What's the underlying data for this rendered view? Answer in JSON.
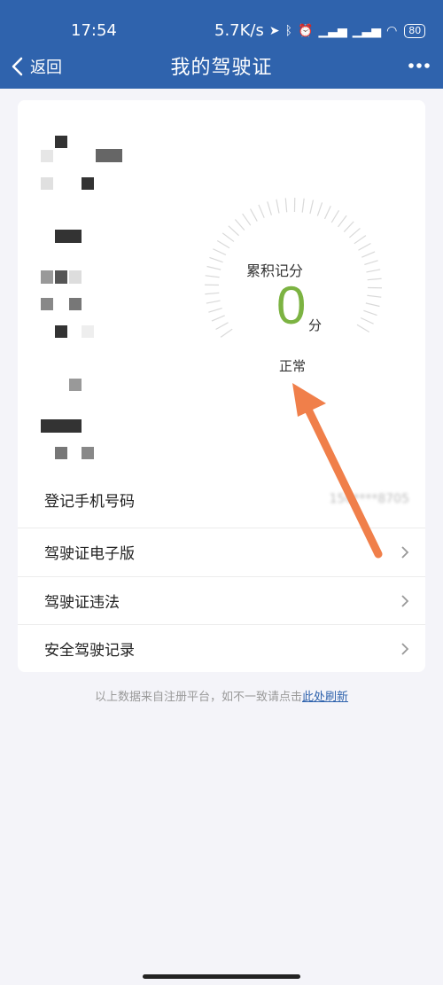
{
  "status_bar": {
    "time": "17:54",
    "net_speed": "5.7K/s",
    "battery": "80",
    "icons": [
      "location-arrow-icon",
      "bluetooth-icon",
      "alarm-icon",
      "signal-icon",
      "wifi-icon",
      "battery-icon"
    ]
  },
  "header": {
    "back_label": "返回",
    "title": "我的驾驶证",
    "more_icon": "more-dots-icon",
    "background_color": "#2f63ad"
  },
  "score_gauge": {
    "label": "累积记分",
    "value": "0",
    "unit": "分",
    "status": "正常",
    "value_color": "#7cb342"
  },
  "menu": {
    "items": [
      {
        "label": "登记手机号码",
        "value": "150****8705"
      },
      {
        "label": "驾驶证电子版"
      },
      {
        "label": "驾驶证违法"
      },
      {
        "label": "安全驾驶记录"
      }
    ]
  },
  "footer": {
    "note": "以上数据来自注册平台，如不一致请点击",
    "link": "此处刷新",
    "link_color": "#2f63ad"
  }
}
